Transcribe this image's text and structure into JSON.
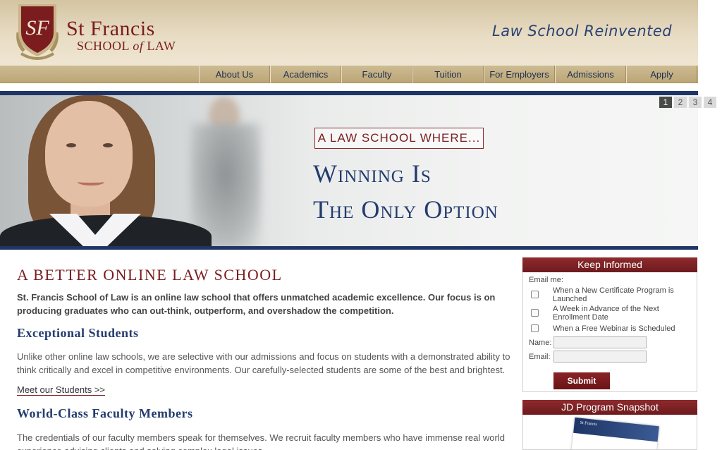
{
  "header": {
    "logo_monogram": "SF",
    "logo_name": "St Francis",
    "logo_sub_prefix": "SCHOOL",
    "logo_sub_of": "of",
    "logo_sub_suffix": "LAW",
    "tagline": "Law School Reinvented"
  },
  "nav": {
    "items": [
      {
        "label": "About Us"
      },
      {
        "label": "Academics"
      },
      {
        "label": "Faculty"
      },
      {
        "label": "Tuition"
      },
      {
        "label": "For Employers"
      },
      {
        "label": "Admissions"
      },
      {
        "label": "Apply"
      }
    ]
  },
  "hero": {
    "slides": [
      "1",
      "2",
      "3",
      "4"
    ],
    "active_slide": "1",
    "kicker": "A LAW SCHOOL WHERE...",
    "headline_line1": "Winning Is",
    "headline_line2": "The Only Option"
  },
  "main": {
    "title": "A BETTER ONLINE LAW SCHOOL",
    "intro": "St. Francis School of Law is an online law school that offers unmatched academic excellence. Our focus is on producing graduates who can out-think, outperform, and overshadow the competition.",
    "section1_title": "Exceptional Students",
    "section1_text": "Unlike other online law schools, we are selective with our admissions and focus on students with a demonstrated ability to think critically and excel in competitive environments. Our carefully-selected students are some of the best and brightest.",
    "section1_link": "Meet our Students >>",
    "section2_title": "World-Class Faculty Members",
    "section2_text": "The credentials of our faculty members speak for themselves.  We recruit faculty members who have immense real world experience advising clients and solving complex legal issues."
  },
  "sidebar": {
    "keep_informed_title": "Keep Informed",
    "email_me": "Email me:",
    "options": [
      {
        "label": "When a New Certificate Program is Launched"
      },
      {
        "label": "A Week in Advance of the Next Enrollment Date"
      },
      {
        "label": "When a Free Webinar is Scheduled"
      }
    ],
    "name_label": "Name:",
    "name_value": "",
    "email_label": "Email:",
    "email_value": "",
    "submit_label": "Submit",
    "snapshot_title": "JD Program Snapshot",
    "snapshot_doc_logo": "St Francis"
  },
  "colors": {
    "brand_red": "#7b1c1f",
    "brand_navy": "#1e3566",
    "header_tan": "#d4c4a2"
  }
}
